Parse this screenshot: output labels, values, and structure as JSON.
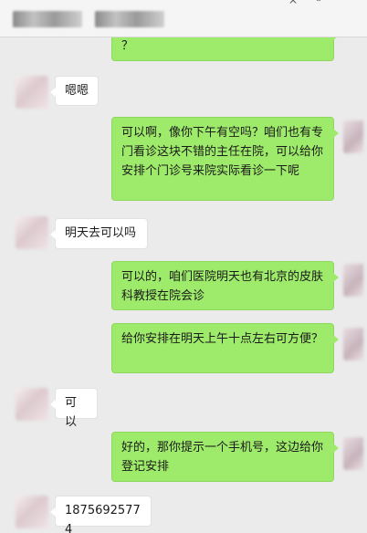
{
  "header": {
    "title_left": "",
    "title_right": "",
    "more_icon": "more-icon"
  },
  "messages": [
    {
      "side": "out",
      "text": "？"
    },
    {
      "side": "in",
      "text": "嗯嗯"
    },
    {
      "side": "out",
      "text": "可以啊，像你下午有空吗？咱们也有专门看诊这块不错的主任在院，可以给你安排个门诊号来院实际看诊一下呢"
    },
    {
      "side": "in",
      "text": "明天去可以吗"
    },
    {
      "side": "out",
      "text": "可以的，咱们医院明天也有北京的皮肤科教授在院会诊"
    },
    {
      "side": "out",
      "text": "给你安排在明天上午十点左右可方便？"
    },
    {
      "side": "in",
      "text": "可以"
    },
    {
      "side": "out",
      "text": "好的，那你提示一个手机号，这边给你登记安排"
    },
    {
      "side": "in",
      "text": "18756925774"
    }
  ]
}
